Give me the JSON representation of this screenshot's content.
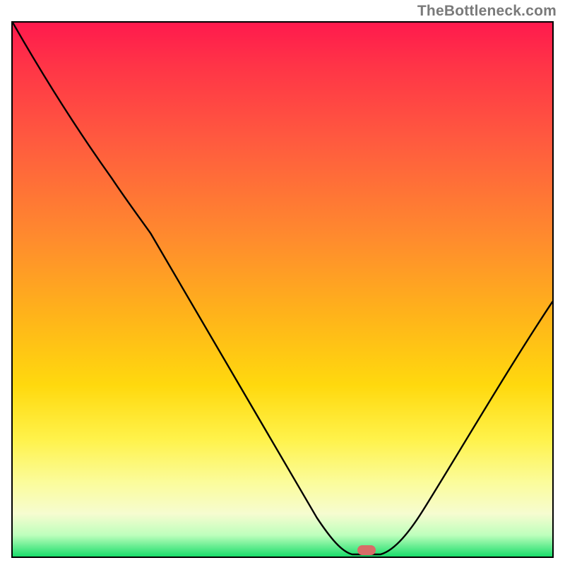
{
  "attribution": "TheBottleneck.com",
  "chart_data": {
    "type": "line",
    "title": "",
    "xlabel": "",
    "ylabel": "",
    "xlim": [
      0,
      100
    ],
    "ylim": [
      0,
      100
    ],
    "x": [
      0,
      5,
      10,
      15,
      20,
      25,
      30,
      35,
      40,
      45,
      50,
      55,
      58,
      60,
      63,
      65,
      67,
      70,
      75,
      80,
      85,
      90,
      95,
      100
    ],
    "values": [
      100,
      91,
      82,
      75,
      70,
      63,
      55,
      47,
      39,
      31,
      23,
      15,
      9,
      5,
      1,
      0,
      0,
      1,
      5,
      12,
      20,
      29,
      38,
      48
    ],
    "marker": {
      "x": 66,
      "y": 0
    },
    "gradient_stops": [
      {
        "pos": 0.0,
        "color": "#ff1a4d"
      },
      {
        "pos": 0.22,
        "color": "#ff5a3f"
      },
      {
        "pos": 0.55,
        "color": "#ffb41a"
      },
      {
        "pos": 0.78,
        "color": "#fff24a"
      },
      {
        "pos": 0.96,
        "color": "#beffbc"
      },
      {
        "pos": 1.0,
        "color": "#1add6b"
      }
    ]
  }
}
